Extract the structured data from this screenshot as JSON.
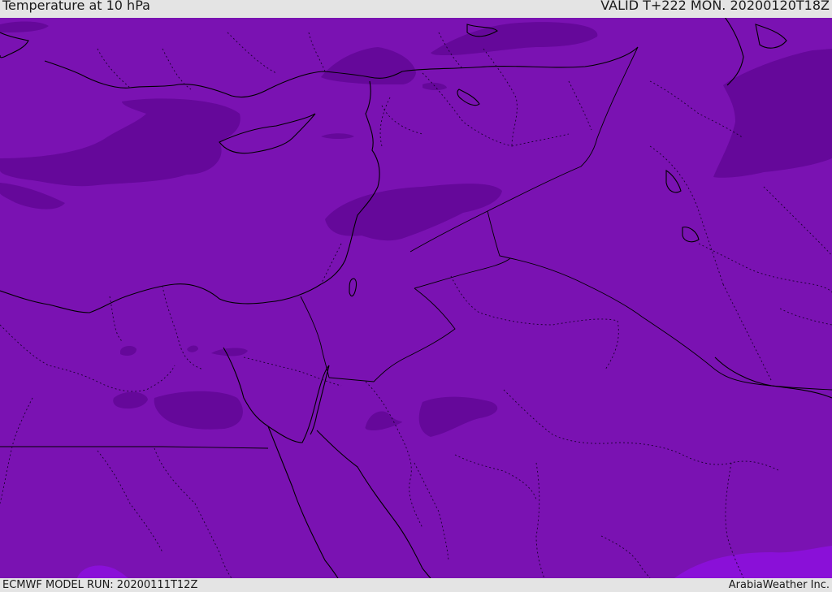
{
  "header": {
    "title": "Temperature at 10 hPa",
    "valid": "VALID T+222 MON. 20200120T18Z"
  },
  "footer": {
    "model_run": "ECMWF MODEL RUN: 20200111T12Z",
    "credit": "ArabiaWeather Inc."
  },
  "colors": {
    "base_field": "#7a12b2",
    "cold_patch": "#65089a",
    "warmer_patch": "#8a10d8",
    "coastline": "#000000",
    "border": "#000000"
  }
}
